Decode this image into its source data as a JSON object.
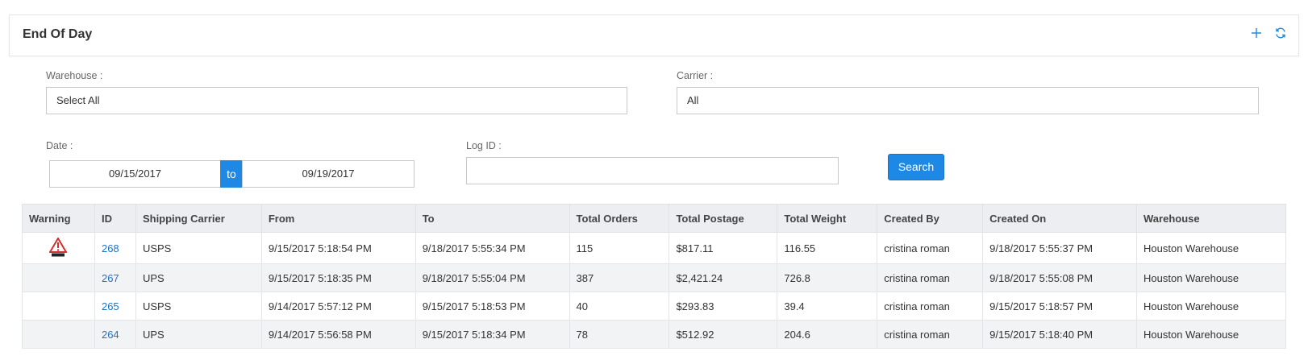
{
  "panel": {
    "title": "End Of Day"
  },
  "filters": {
    "warehouse_label": "Warehouse :",
    "warehouse_value": "Select All",
    "carrier_label": "Carrier :",
    "carrier_value": "All",
    "date_label": "Date :",
    "date_from": "09/15/2017",
    "date_to_label": "to",
    "date_to": "09/19/2017",
    "logid_label": "Log ID :",
    "logid_value": "",
    "search_label": "Search"
  },
  "table": {
    "headers": [
      "Warning",
      "ID",
      "Shipping Carrier",
      "From",
      "To",
      "Total Orders",
      "Total Postage",
      "Total Weight",
      "Created By",
      "Created On",
      "Warehouse"
    ],
    "rows": [
      {
        "warning": true,
        "id": "268",
        "carrier": "USPS",
        "from": "9/15/2017 5:18:54 PM",
        "to": "9/18/2017 5:55:34 PM",
        "orders": "115",
        "postage": "$817.11",
        "weight": "116.55",
        "created_by": "cristina roman",
        "created_on": "9/18/2017 5:55:37 PM",
        "warehouse": "Houston Warehouse"
      },
      {
        "warning": false,
        "id": "267",
        "carrier": "UPS",
        "from": "9/15/2017 5:18:35 PM",
        "to": "9/18/2017 5:55:04 PM",
        "orders": "387",
        "postage": "$2,421.24",
        "weight": "726.8",
        "created_by": "cristina roman",
        "created_on": "9/18/2017 5:55:08 PM",
        "warehouse": "Houston Warehouse"
      },
      {
        "warning": false,
        "id": "265",
        "carrier": "USPS",
        "from": "9/14/2017 5:57:12 PM",
        "to": "9/15/2017 5:18:53 PM",
        "orders": "40",
        "postage": "$293.83",
        "weight": "39.4",
        "created_by": "cristina roman",
        "created_on": "9/15/2017 5:18:57 PM",
        "warehouse": "Houston Warehouse"
      },
      {
        "warning": false,
        "id": "264",
        "carrier": "UPS",
        "from": "9/14/2017 5:56:58 PM",
        "to": "9/15/2017 5:18:34 PM",
        "orders": "78",
        "postage": "$512.92",
        "weight": "204.6",
        "created_by": "cristina roman",
        "created_on": "9/15/2017 5:18:40 PM",
        "warehouse": "Houston Warehouse"
      }
    ]
  },
  "colors": {
    "accent": "#1e88e5",
    "warning": "#d32f2f"
  }
}
